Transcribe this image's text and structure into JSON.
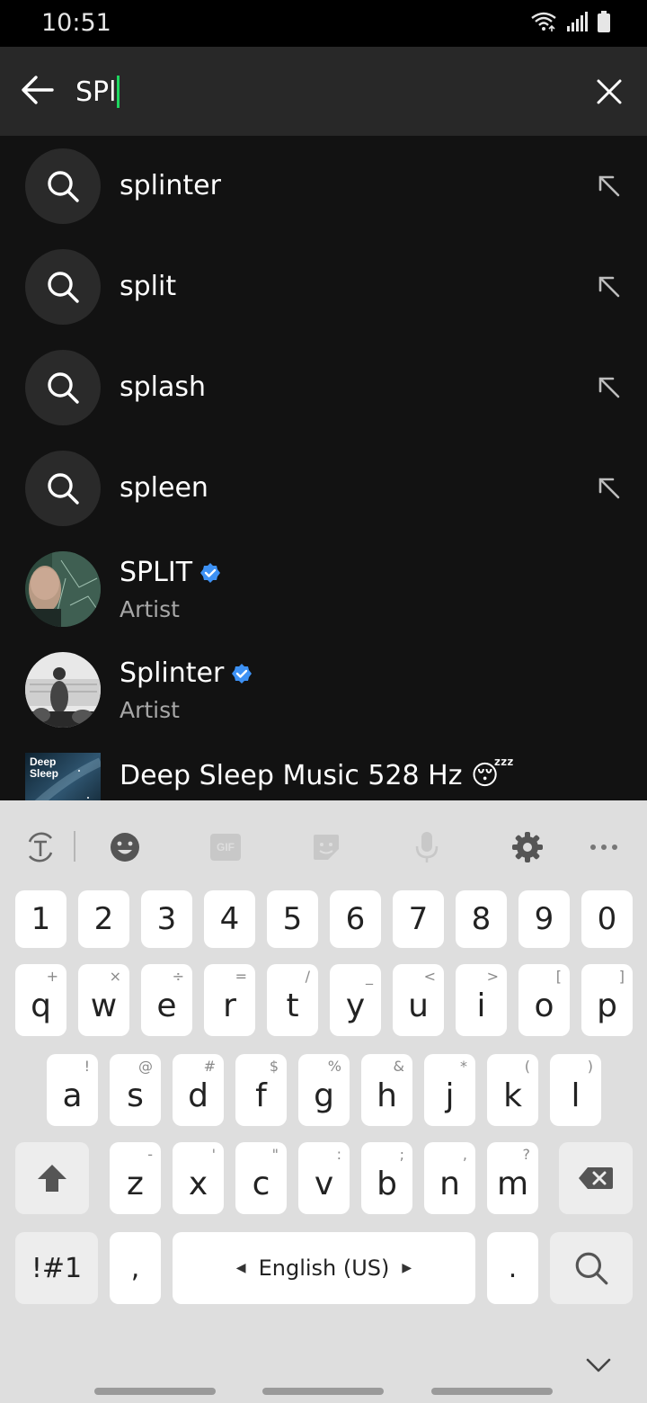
{
  "status_bar": {
    "time": "10:51",
    "icons": [
      "wifi-icon",
      "signal-icon",
      "battery-icon"
    ]
  },
  "search": {
    "query": "SPl",
    "back_icon": "back-arrow-icon",
    "clear_icon": "close-icon"
  },
  "suggestions": [
    {
      "text": "splinter",
      "icon": "search-icon",
      "action_icon": "fill-query-arrow-icon"
    },
    {
      "text": "split",
      "icon": "search-icon",
      "action_icon": "fill-query-arrow-icon"
    },
    {
      "text": "splash",
      "icon": "search-icon",
      "action_icon": "fill-query-arrow-icon"
    },
    {
      "text": "spleen",
      "icon": "search-icon",
      "action_icon": "fill-query-arrow-icon"
    }
  ],
  "artists": [
    {
      "name": "SPLIT",
      "type": "Artist",
      "verified": true
    },
    {
      "name": "Splinter",
      "type": "Artist",
      "verified": true
    }
  ],
  "playlist": {
    "title": "Deep Sleep Music 528 Hz 😴",
    "cover_text_line1": "Deep",
    "cover_text_line2": "Sleep"
  },
  "keyboard": {
    "toolbar": [
      "text-translate-icon",
      "emoji-icon",
      "gif-icon",
      "sticker-icon",
      "mic-icon",
      "settings-icon",
      "more-icon"
    ],
    "gif_label": "GIF",
    "numbers": [
      "1",
      "2",
      "3",
      "4",
      "5",
      "6",
      "7",
      "8",
      "9",
      "0"
    ],
    "row1": [
      {
        "k": "q",
        "h": "+"
      },
      {
        "k": "w",
        "h": "×"
      },
      {
        "k": "e",
        "h": "÷"
      },
      {
        "k": "r",
        "h": "="
      },
      {
        "k": "t",
        "h": "/"
      },
      {
        "k": "y",
        "h": "_"
      },
      {
        "k": "u",
        "h": "<"
      },
      {
        "k": "i",
        "h": ">"
      },
      {
        "k": "o",
        "h": "["
      },
      {
        "k": "p",
        "h": "]"
      }
    ],
    "row2": [
      {
        "k": "a",
        "h": "!"
      },
      {
        "k": "s",
        "h": "@"
      },
      {
        "k": "d",
        "h": "#"
      },
      {
        "k": "f",
        "h": "$"
      },
      {
        "k": "g",
        "h": "%"
      },
      {
        "k": "h",
        "h": "&"
      },
      {
        "k": "j",
        "h": "*"
      },
      {
        "k": "k",
        "h": "("
      },
      {
        "k": "l",
        "h": ")"
      }
    ],
    "row3": [
      {
        "k": "z",
        "h": "-"
      },
      {
        "k": "x",
        "h": "'"
      },
      {
        "k": "c",
        "h": "\""
      },
      {
        "k": "v",
        "h": ":"
      },
      {
        "k": "b",
        "h": ";"
      },
      {
        "k": "n",
        "h": ","
      },
      {
        "k": "m",
        "h": "?"
      }
    ],
    "symbols_label": "!#1",
    "comma_label": ",",
    "space_label": "English (US)",
    "period_label": ".",
    "accent_color": "#1ed760",
    "verified_color": "#3d91f4"
  }
}
